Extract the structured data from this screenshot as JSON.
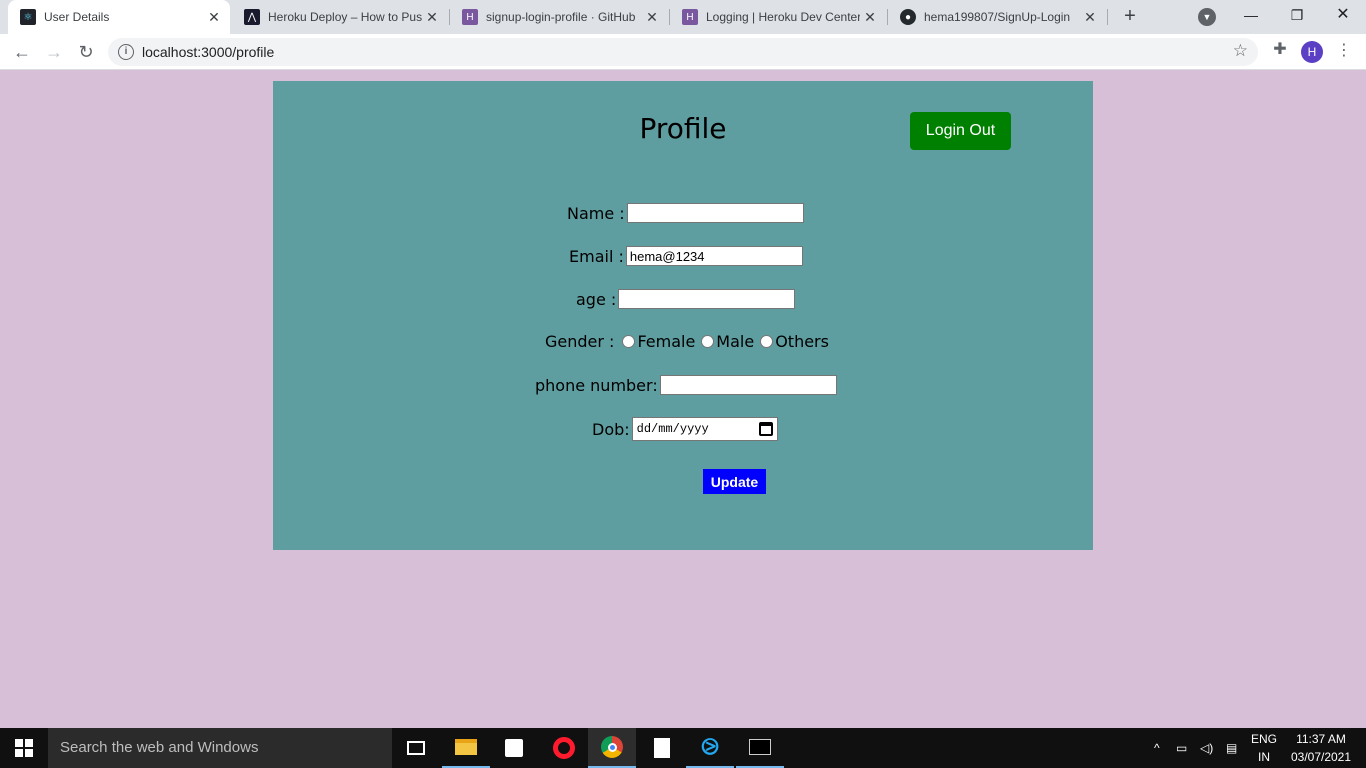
{
  "browser": {
    "tabs": [
      {
        "title": "User Details",
        "active": true
      },
      {
        "title": "Heroku Deploy – How to Push"
      },
      {
        "title": "signup-login-profile · GitHub"
      },
      {
        "title": "Logging | Heroku Dev Center"
      },
      {
        "title": "hema199807/SignUp-Login"
      }
    ],
    "url": "localhost:3000/profile",
    "profile_initial": "H"
  },
  "page": {
    "title": "Profile",
    "logout_label": "Login Out",
    "fields": {
      "name_label": "Name :",
      "name_value": "",
      "email_label": "Email :",
      "email_value": "hema@1234",
      "age_label": "age :",
      "age_value": "",
      "gender_label": "Gender :",
      "gender_options": [
        "Female",
        "Male",
        "Others"
      ],
      "phone_label": "phone number:",
      "phone_value": "",
      "dob_label": "Dob:",
      "dob_placeholder": "dd/mm/yyyy"
    },
    "update_label": "Update",
    "colors": {
      "page_bg": "#d8bfd8",
      "card_bg": "#5f9ea0",
      "logout_bg": "#008000",
      "update_bg": "#0000ff"
    }
  },
  "taskbar": {
    "search_placeholder": "Search the web and Windows",
    "lang": "ENG",
    "region": "IN",
    "time": "11:37 AM",
    "date": "03/07/2021"
  }
}
